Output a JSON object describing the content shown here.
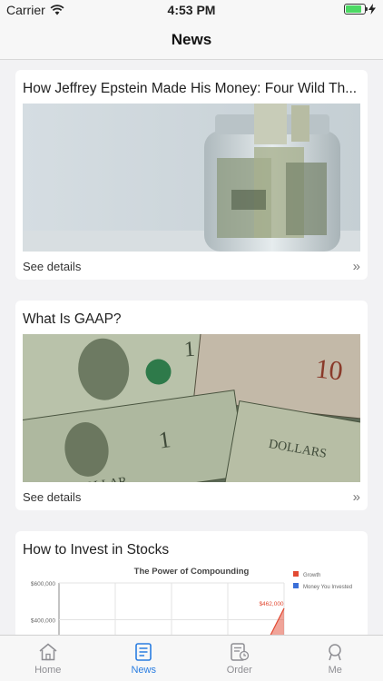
{
  "status": {
    "carrier": "Carrier",
    "time": "4:53 PM",
    "battery_level": 0.85
  },
  "nav": {
    "title": "News"
  },
  "articles": [
    {
      "title": "How Jeffrey Epstein Made His Money: Four Wild Th...",
      "details_label": "See details",
      "image": "money-jar-image"
    },
    {
      "title": "What Is GAAP?",
      "details_label": "See details",
      "image": "dollar-bills-image"
    },
    {
      "title": "How to Invest in Stocks",
      "image": "compounding-chart-image"
    }
  ],
  "chart_data": {
    "type": "area",
    "title": "The Power of Compounding",
    "y_ticks": [
      "$600,000",
      "$400,000"
    ],
    "ylim": [
      0,
      600000
    ],
    "legend": [
      "Growth",
      "Money You Invested"
    ],
    "legend_position": "top-right",
    "annotations": [
      "$462,000"
    ],
    "colors": {
      "growth": "#e24a33",
      "money_invested": "#3b6fd8"
    }
  },
  "tabs": [
    {
      "label": "Home",
      "icon": "home-icon",
      "active": false
    },
    {
      "label": "News",
      "icon": "news-icon",
      "active": true
    },
    {
      "label": "Order",
      "icon": "order-icon",
      "active": false
    },
    {
      "label": "Me",
      "icon": "me-icon",
      "active": false
    }
  ],
  "colors": {
    "accent": "#2a7de1",
    "background": "#f2f2f4"
  }
}
